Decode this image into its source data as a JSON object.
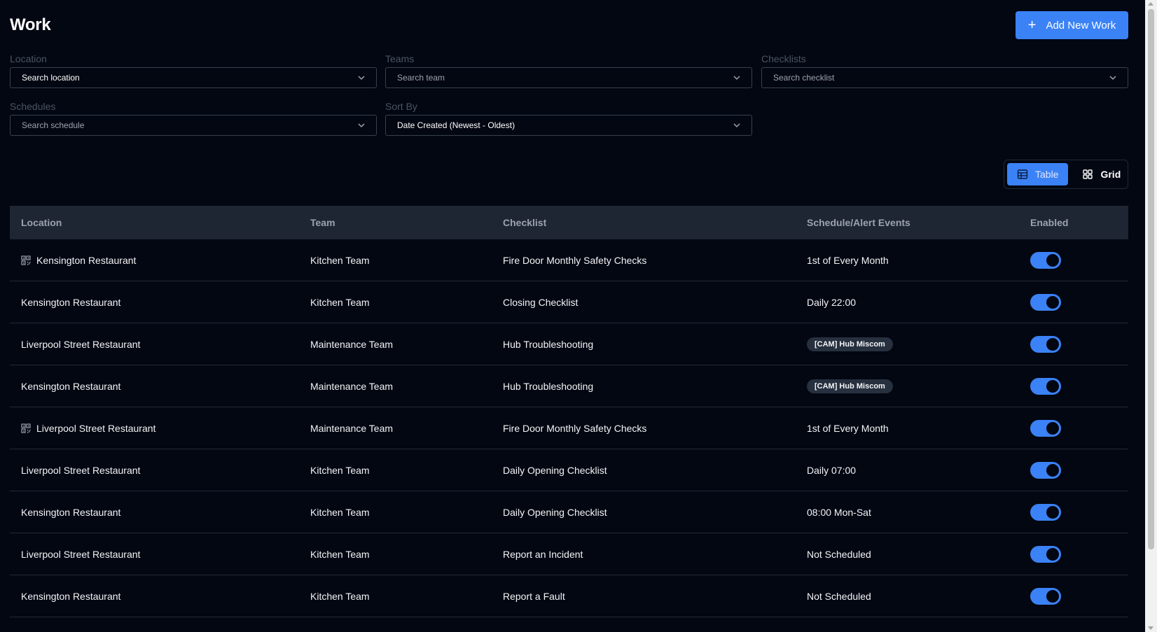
{
  "page": {
    "title": "Work",
    "add_button_label": "Add New Work"
  },
  "filters": {
    "location": {
      "label": "Location",
      "value": "Search location"
    },
    "teams": {
      "label": "Teams",
      "value": "Search team"
    },
    "checklists": {
      "label": "Checklists",
      "value": "Search checklist"
    },
    "schedules": {
      "label": "Schedules",
      "value": "Search schedule"
    },
    "sort_by": {
      "label": "Sort By",
      "value": "Date Created (Newest - Oldest)"
    }
  },
  "view_toggle": {
    "table_label": "Table",
    "grid_label": "Grid",
    "active": "table"
  },
  "table": {
    "headers": [
      "Location",
      "Team",
      "Checklist",
      "Schedule/Alert Events",
      "Enabled"
    ],
    "rows": [
      {
        "location": "Kensington Restaurant",
        "qr": true,
        "team": "Kitchen Team",
        "checklist": "Fire Door Monthly Safety Checks",
        "schedule": "1st of Every Month",
        "schedule_badge": false,
        "enabled": true
      },
      {
        "location": "Kensington Restaurant",
        "qr": false,
        "team": "Kitchen Team",
        "checklist": "Closing Checklist",
        "schedule": "Daily 22:00",
        "schedule_badge": false,
        "enabled": true
      },
      {
        "location": "Liverpool Street Restaurant",
        "qr": false,
        "team": "Maintenance Team",
        "checklist": "Hub Troubleshooting",
        "schedule": "[CAM] Hub Miscom",
        "schedule_badge": true,
        "enabled": true
      },
      {
        "location": "Kensington Restaurant",
        "qr": false,
        "team": "Maintenance Team",
        "checklist": "Hub Troubleshooting",
        "schedule": "[CAM] Hub Miscom",
        "schedule_badge": true,
        "enabled": true
      },
      {
        "location": "Liverpool Street Restaurant",
        "qr": true,
        "team": "Maintenance Team",
        "checklist": "Fire Door Monthly Safety Checks",
        "schedule": "1st of Every Month",
        "schedule_badge": false,
        "enabled": true
      },
      {
        "location": "Liverpool Street Restaurant",
        "qr": false,
        "team": "Kitchen Team",
        "checklist": "Daily Opening Checklist",
        "schedule": "Daily 07:00",
        "schedule_badge": false,
        "enabled": true
      },
      {
        "location": "Kensington Restaurant",
        "qr": false,
        "team": "Kitchen Team",
        "checklist": "Daily Opening Checklist",
        "schedule": "08:00 Mon-Sat",
        "schedule_badge": false,
        "enabled": true
      },
      {
        "location": "Liverpool Street Restaurant",
        "qr": false,
        "team": "Kitchen Team",
        "checklist": "Report an Incident",
        "schedule": "Not Scheduled",
        "schedule_badge": false,
        "enabled": true
      },
      {
        "location": "Kensington Restaurant",
        "qr": false,
        "team": "Kitchen Team",
        "checklist": "Report a Fault",
        "schedule": "Not Scheduled",
        "schedule_badge": false,
        "enabled": true
      }
    ]
  },
  "colors": {
    "background": "#030712",
    "accent": "#3b82f6",
    "table_header": "#1e2533"
  }
}
